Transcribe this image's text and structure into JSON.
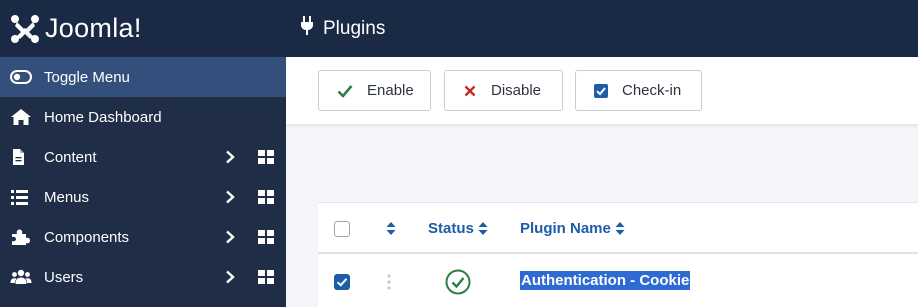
{
  "brand": {
    "name": "Joomla!"
  },
  "sidebar": {
    "items": [
      {
        "label": "Toggle Menu",
        "icon": "toggle-icon"
      },
      {
        "label": "Home Dashboard",
        "icon": "home-icon"
      },
      {
        "label": "Content",
        "icon": "file-icon"
      },
      {
        "label": "Menus",
        "icon": "list-icon"
      },
      {
        "label": "Components",
        "icon": "puzzle-icon"
      },
      {
        "label": "Users",
        "icon": "users-icon"
      }
    ]
  },
  "header": {
    "title": "Plugins",
    "icon": "plug-icon"
  },
  "toolbar": {
    "enable_label": "Enable",
    "disable_label": "Disable",
    "checkin_label": "Check-in"
  },
  "table": {
    "columns": {
      "status": "Status",
      "plugin_name": "Plugin Name"
    },
    "rows": [
      {
        "name": "Authentication - Cookie",
        "checked": true,
        "enabled": true
      }
    ]
  },
  "colors": {
    "sidebar_bg": "#1f2d47",
    "header_bg": "#1b2a44",
    "active_item": "#33507c",
    "link_blue": "#1d5ca8",
    "success_green": "#2e7d46",
    "danger_red": "#c52827",
    "selection": "#2d6bd3"
  }
}
